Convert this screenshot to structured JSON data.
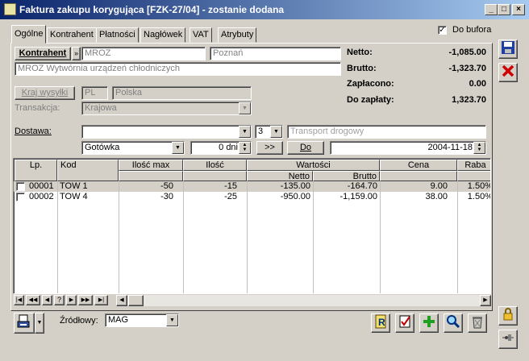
{
  "window": {
    "title": "Faktura zakupu korygująca [FZK-27/04]  - zostanie dodana"
  },
  "tabs": [
    {
      "label": "Ogólne"
    },
    {
      "label": "Kontrahent"
    },
    {
      "label": "Płatności"
    },
    {
      "label": "Nagłówek"
    },
    {
      "label": "VAT"
    },
    {
      "label": "Atrybuty"
    }
  ],
  "do_bufora": {
    "label": "Do bufora",
    "checked": true
  },
  "contractor": {
    "button_label": "Kontrahent",
    "code": "MROZ",
    "city": "Poznań",
    "name": "MROZ Wytwórnia urządzeń chłodniczych"
  },
  "country": {
    "button_label": "Kraj wysyłki",
    "code": "PL",
    "name": "Polska"
  },
  "transaction": {
    "label": "Transakcja:",
    "value": "Krajowa"
  },
  "delivery": {
    "label": "Dostawa:",
    "value": "",
    "number": "3",
    "method": "Transport drogowy",
    "payment": "Gotówka",
    "days": "0 dni",
    "arrow_label": ">>",
    "do_label": "Do",
    "date": "2004-11-18"
  },
  "summary": {
    "netto_label": "Netto:",
    "netto": "-1,085.00",
    "brutto_label": "Brutto:",
    "brutto": "-1,323.70",
    "paid_label": "Zapłacono:",
    "paid": "0.00",
    "due_label": "Do zapłaty:",
    "due": "1,323.70"
  },
  "table": {
    "headers": {
      "lp": "Lp.",
      "kod": "Kod",
      "ilosc_max": "Ilość max",
      "ilosc": "Ilość",
      "wartosci": "Wartości",
      "netto": "Netto",
      "brutto": "Brutto",
      "cena": "Cena",
      "rabat": "Raba"
    },
    "rows": [
      {
        "lp": "00001",
        "kod": "TOW 1",
        "ilosc_max": "-50",
        "ilosc": "-15",
        "netto": "-135.00",
        "brutto": "-164.70",
        "cena": "9.00",
        "rabat": "1.50%"
      },
      {
        "lp": "00002",
        "kod": "TOW 4",
        "ilosc_max": "-30",
        "ilosc": "-25",
        "netto": "-950.00",
        "brutto": "-1,159.00",
        "cena": "38.00",
        "rabat": "1.50%"
      }
    ]
  },
  "bottom": {
    "source_label": "Źródłowy:",
    "source_value": "MAG"
  },
  "nav_buttons": [
    "|◀",
    "◀◀",
    "◀",
    "?",
    "▶",
    "▶▶",
    "▶|"
  ]
}
